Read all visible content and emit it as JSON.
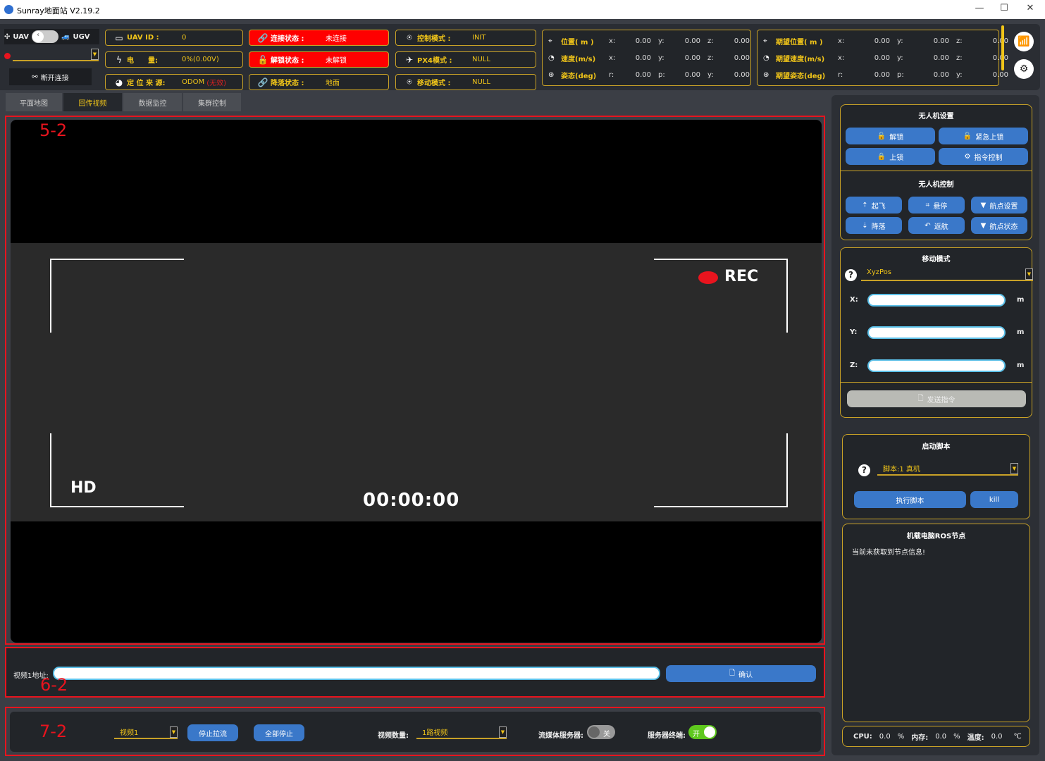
{
  "window": {
    "title": "Sunray地面站 V2.19.2",
    "min": "—",
    "max": "☐",
    "close": "✕"
  },
  "vehicle_toggle": {
    "left": "UAV",
    "right": "UGV",
    "selected": "UAV"
  },
  "connection": {
    "selector_value": "",
    "disconnect_label": "断开连接",
    "indicator_color": "#e8141e"
  },
  "status": {
    "uav_id": {
      "label": "UAV ID :",
      "value": "0"
    },
    "battery": {
      "label": "电　　量:",
      "value": "0%(0.00V)"
    },
    "location_source": {
      "label": "定 位 来 源:",
      "value": "ODOM",
      "invalid": "(无效)"
    },
    "connect_state": {
      "label": "连接状态 :",
      "value": "未连接"
    },
    "arm_state": {
      "label": "解锁状态 :",
      "value": "未解锁"
    },
    "landing_state": {
      "label": "降落状态 :",
      "value": "地面"
    },
    "control_mode": {
      "label": "控制模式 :",
      "value": "INIT"
    },
    "px4_mode": {
      "label": "PX4模式 :",
      "value": "NULL"
    },
    "move_mode": {
      "label": "移动模式 :",
      "value": "NULL"
    }
  },
  "telemetry": {
    "rows": [
      {
        "label": "位置( m )",
        "k": [
          "x:",
          "y:",
          "z:"
        ],
        "v": [
          "0.00",
          "0.00",
          "0.00"
        ]
      },
      {
        "label": "速度(m/s)",
        "k": [
          "x:",
          "y:",
          "z:"
        ],
        "v": [
          "0.00",
          "0.00",
          "0.00"
        ]
      },
      {
        "label": "姿态(deg)",
        "k": [
          "r:",
          "p:",
          "y:"
        ],
        "v": [
          "0.00",
          "0.00",
          "0.00"
        ]
      }
    ],
    "desired": [
      {
        "label": "期望位置( m )",
        "k": [
          "x:",
          "y:",
          "z:"
        ],
        "v": [
          "0.00",
          "0.00",
          "0.00"
        ]
      },
      {
        "label": "期望速度(m/s)",
        "k": [
          "x:",
          "y:",
          "z:"
        ],
        "v": [
          "0.00",
          "0.00",
          "0.00"
        ]
      },
      {
        "label": "期望姿态(deg)",
        "k": [
          "r:",
          "p:",
          "y:"
        ],
        "v": [
          "0.00",
          "0.00",
          "0.00"
        ]
      }
    ]
  },
  "tabs": [
    {
      "label": "平面地图"
    },
    {
      "label": "回传视频",
      "active": true
    },
    {
      "label": "数据监控"
    },
    {
      "label": "集群控制"
    }
  ],
  "video": {
    "tag": "5-2",
    "rec": "REC",
    "hd": "HD",
    "timecode": "00:00:00"
  },
  "address": {
    "tag": "6-2",
    "label": "视频1地址:",
    "value": "",
    "confirm": "确认"
  },
  "stream": {
    "tag": "7-2",
    "video_select": "视频1",
    "stop_pull": "停止拉流",
    "stop_all": "全部停止",
    "count_label": "视频数量:",
    "count_value": "1路视频",
    "media_server_label": "流媒体服务器:",
    "media_server_state": "关",
    "terminal_label": "服务器终端:",
    "terminal_state": "开"
  },
  "uav_settings": {
    "title": "无人机设置",
    "buttons": [
      "解锁",
      "紧急上锁",
      "上锁",
      "指令控制"
    ]
  },
  "uav_control": {
    "title": "无人机控制",
    "buttons": [
      "起飞",
      "悬停",
      "航点设置",
      "降落",
      "返航",
      "航点状态"
    ]
  },
  "move_mode": {
    "title": "移动模式",
    "select": "XyzPos",
    "x_label": "X:",
    "y_label": "Y:",
    "z_label": "Z:",
    "unit": "m",
    "x": "",
    "y": "",
    "z": "",
    "send": "发送指令"
  },
  "script": {
    "title": "启动脚本",
    "select": "脚本:1 真机",
    "run": "执行脚本",
    "kill": "kill"
  },
  "ros_nodes": {
    "title": "机载电脑ROS节点",
    "message": "当前未获取到节点信息!"
  },
  "system": {
    "cpu_label": "CPU:",
    "cpu": "0.0",
    "pct": "%",
    "mem_label": "内存:",
    "mem": "0.0",
    "temp_label": "温度:",
    "temp": "0.0",
    "temp_unit": "℃"
  },
  "colors": {
    "accent": "#f0c419",
    "border": "#c9a227",
    "alert": "#ff0000",
    "button": "#3a78c9",
    "toggle_on": "#5fc81e"
  }
}
